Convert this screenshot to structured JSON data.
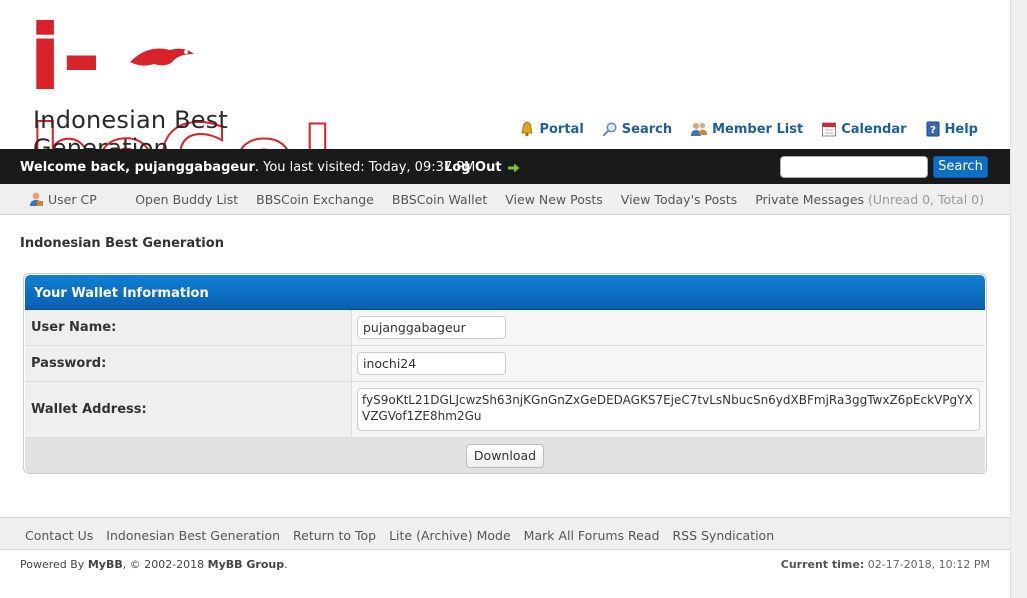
{
  "header": {
    "logo_text": "i-beGo!",
    "tagline": "Indonesian Best Generation",
    "top_links": [
      {
        "label": "Portal",
        "icon": "bell-icon"
      },
      {
        "label": "Search",
        "icon": "search-icon"
      },
      {
        "label": "Member List",
        "icon": "members-icon"
      },
      {
        "label": "Calendar",
        "icon": "calendar-icon"
      },
      {
        "label": "Help",
        "icon": "help-icon"
      }
    ]
  },
  "welcome_bar": {
    "welcome_prefix": "Welcome back, ",
    "username": "pujanggabageur",
    "last_visit": ". You last visited: Today, 09:37 PM",
    "logout_label": "Log Out",
    "search_placeholder": "",
    "search_button": "Search"
  },
  "usercp_bar": {
    "usercp_label": "User CP",
    "links": [
      "Open Buddy List",
      "BBSCoin Exchange",
      "BBSCoin Wallet",
      "View New Posts",
      "View Today's Posts"
    ],
    "pm_label": "Private Messages",
    "pm_counts": "(Unread 0, Total 0)"
  },
  "breadcrumb": "Indonesian Best Generation",
  "wallet": {
    "title": "Your Wallet Information",
    "username_label": "User Name:",
    "username_value": "pujanggabageur",
    "password_label": "Password:",
    "password_value": "inochi24",
    "address_label": "Wallet Address:",
    "address_value": "fyS9oKtL21DGLJcwzSh63njKGnGnZxGeDEDAGKS7EjeC7tvLsNbucSn6ydXBFmjRa3ggTwxZ6pEckVPgYXVZGVof1ZE8hm2Gu",
    "download_label": "Download"
  },
  "footer": {
    "links": [
      "Contact Us",
      "Indonesian Best Generation",
      "Return to Top",
      "Lite (Archive) Mode",
      "Mark All Forums Read",
      "RSS Syndication"
    ],
    "powered_prefix": "Powered By ",
    "powered_brand": "MyBB",
    "powered_mid": ", © 2002-2018 ",
    "powered_group": "MyBB Group",
    "powered_suffix": ".",
    "time_label": "Current time:",
    "time_value": "02-17-2018, 10:12 PM"
  },
  "colors": {
    "brand_red": "#d8232a",
    "link_blue": "#1e5f9f",
    "header_blue": "#0f7fd6",
    "bar_black": "#1a1a1a"
  }
}
